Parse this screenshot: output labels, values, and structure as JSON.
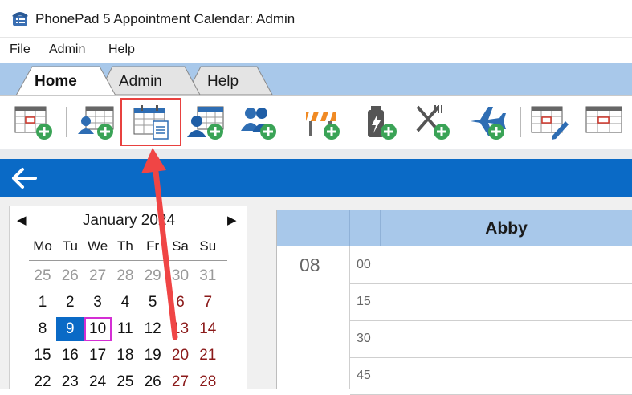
{
  "window": {
    "title": "PhonePad 5 Appointment Calendar: Admin"
  },
  "menu": {
    "items": [
      "File",
      "Admin",
      "Help"
    ]
  },
  "ribbon": {
    "tabs": [
      "Home",
      "Admin",
      "Help"
    ],
    "active_tab": "Home"
  },
  "toolbar": {
    "tools": [
      "new-appointment-icon",
      "staff-schedule-icon",
      "calendar-notes-icon",
      "staff-calendar-icon",
      "add-group-icon",
      "roadblock-icon",
      "battery-icon",
      "meal-break-icon",
      "travel-icon",
      "edit-calendar-icon",
      "calendar-settings-icon"
    ],
    "highlighted_tool": "calendar-notes-icon"
  },
  "calendar": {
    "month_label": "January 2024",
    "weekdays": [
      "Mo",
      "Tu",
      "We",
      "Th",
      "Fr",
      "Sa",
      "Su"
    ],
    "weeks": [
      [
        "25",
        "26",
        "27",
        "28",
        "29",
        "30",
        "31"
      ],
      [
        "1",
        "2",
        "3",
        "4",
        "5",
        "6",
        "7"
      ],
      [
        "8",
        "9",
        "10",
        "11",
        "12",
        "13",
        "14"
      ],
      [
        "15",
        "16",
        "17",
        "18",
        "19",
        "20",
        "21"
      ],
      [
        "22",
        "23",
        "24",
        "25",
        "26",
        "27",
        "28"
      ]
    ],
    "selected_day": "9",
    "today": "10"
  },
  "schedule": {
    "staff_name": "Abby",
    "hour": "08",
    "slots": [
      "00",
      "15",
      "30",
      "45"
    ]
  },
  "colors": {
    "accent_blue": "#0a6ac6",
    "ribbon_blue": "#a8c8ea",
    "weekend_red": "#8b1a1a",
    "highlight_red": "#e8413f",
    "today_magenta": "#d42ed4"
  }
}
